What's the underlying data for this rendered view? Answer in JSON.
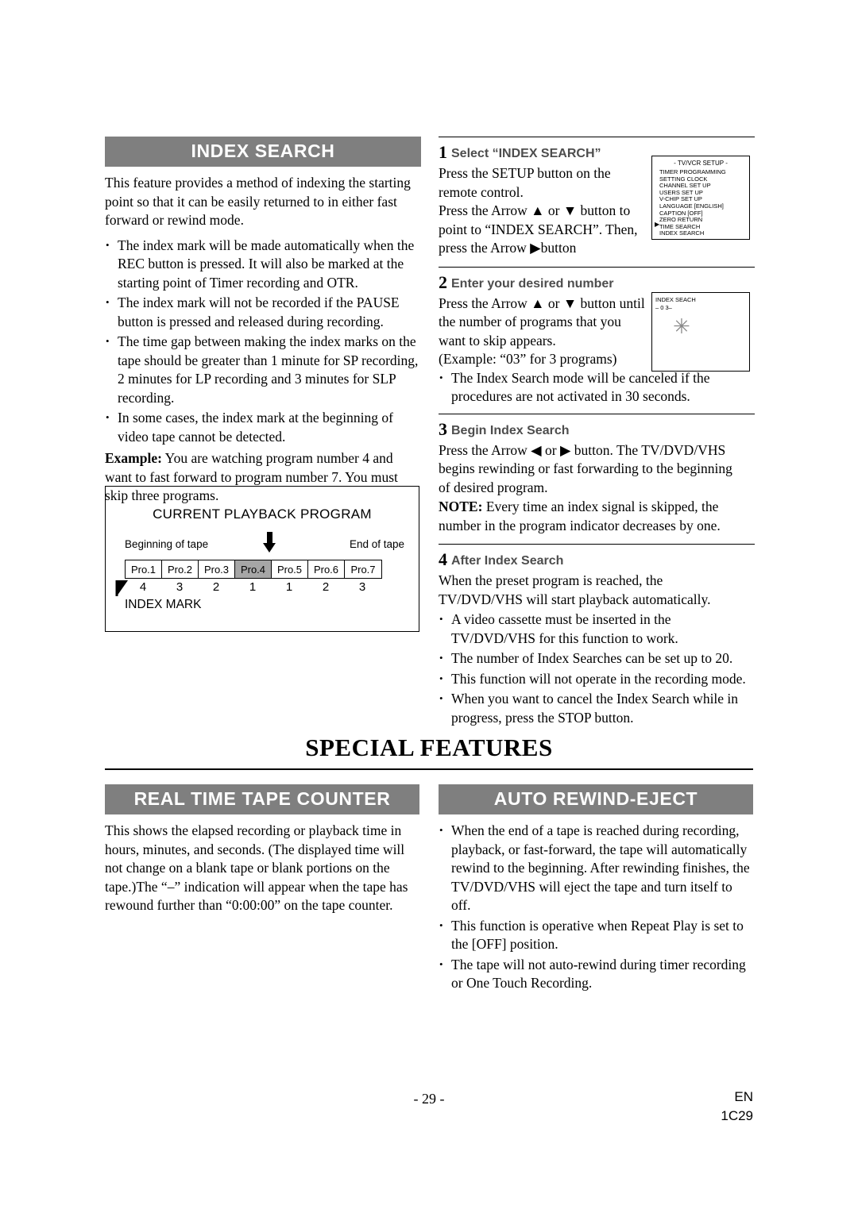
{
  "left": {
    "heading": "INDEX SEARCH",
    "intro": "This feature provides a method of indexing the starting point so that it can be easily returned to in either fast forward or rewind mode.",
    "bullets": [
      "The index mark will be made automatically when the REC button is pressed. It will also be marked at the starting point of Timer recording and OTR.",
      "The index mark will not be recorded if the PAUSE button is pressed and released during recording.",
      "The time gap between making the index marks on the tape should be greater than 1 minute for SP recording, 2 minutes for LP recording and 3 minutes for SLP recording.",
      "In some cases, the index mark at the beginning of video tape cannot be detected."
    ],
    "example_label": "Example:",
    "example_text": " You are watching program number 4 and want to fast forward to program number 7. You must skip three programs."
  },
  "diagram": {
    "title": "CURRENT PLAYBACK PROGRAM",
    "beginning_label": "Beginning of tape",
    "end_label": "End of tape",
    "programs": [
      "Pro.1",
      "Pro.2",
      "Pro.3",
      "Pro.4",
      "Pro.5",
      "Pro.6",
      "Pro.7"
    ],
    "highlight_index": 3,
    "numbers": [
      "4",
      "3",
      "2",
      "1",
      "1",
      "2",
      "3"
    ],
    "index_mark_label": "INDEX MARK"
  },
  "right": {
    "steps": [
      {
        "num": "1",
        "title": "Select “INDEX SEARCH”",
        "lines": [
          "Press the SETUP button on the",
          "remote control.",
          "Press the Arrow ▲ or ▼ button to",
          "point to “INDEX SEARCH”. Then,",
          "press the Arrow ▶button"
        ]
      },
      {
        "num": "2",
        "title": "Enter your desired number",
        "lines": [
          "Press the Arrow ▲ or ▼ button until",
          "the number of programs that you",
          "want to skip appears.",
          "(Example: “03” for 3 programs)"
        ],
        "bullets": [
          "The Index Search mode will be canceled if the procedures are not activated in 30 seconds."
        ]
      },
      {
        "num": "3",
        "title": "Begin Index Search",
        "lines": [
          "Press the Arrow ◀ or ▶ button. The TV/DVD/VHS",
          "begins rewinding or fast forwarding to the beginning",
          "of desired program."
        ],
        "note_label": "NOTE:",
        "note_text": " Every time an index signal is skipped, the number in the program indicator decreases by one."
      },
      {
        "num": "4",
        "title": "After Index Search",
        "lines": [
          "When the preset program is reached, the",
          "TV/DVD/VHS will start playback automatically."
        ],
        "bullets": [
          "A video cassette must be inserted in the TV/DVD/VHS for this function to work.",
          "The number of Index Searches can be set up to 20.",
          "This function will not operate in the recording mode.",
          "When you want to cancel the Index Search while in progress, press the STOP button."
        ]
      }
    ]
  },
  "setup_screen": {
    "title": "- TV/VCR SETUP -",
    "items": [
      "TIMER PROGRAMMING",
      "SETTING CLOCK",
      "CHANNEL SET UP",
      "USERS SET UP",
      "V-CHIP SET UP",
      "LANGUAGE  [ENGLISH]",
      "CAPTION  [OFF]",
      "ZERO RETURN",
      "TIME SEARCH",
      "INDEX SEARCH"
    ],
    "pointer": "▶"
  },
  "index_screen": {
    "title": "INDEX SEACH",
    "number": "– 0 3–",
    "sparkle": "✳"
  },
  "special": {
    "title": "SPECIAL FEATURES",
    "left": {
      "heading": "REAL TIME TAPE COUNTER",
      "text": "This shows the elapsed recording or playback time in hours, minutes, and seconds. (The displayed time will not change on a blank tape or blank portions on the tape.)The “–” indication will appear when the tape has rewound further than “0:00:00” on the tape counter."
    },
    "right": {
      "heading": "AUTO REWIND-EJECT",
      "bullets": [
        "When the end of a tape is reached during recording, playback, or fast-forward, the tape will automatically rewind to the beginning. After rewinding finishes, the TV/DVD/VHS will eject the tape and turn itself to off.",
        "This function is operative when Repeat Play is set to the [OFF] position.",
        "The tape will not auto-rewind during timer recording or One Touch Recording."
      ]
    }
  },
  "footer": {
    "page": "- 29 -",
    "lang": "EN",
    "code": "1C29"
  }
}
